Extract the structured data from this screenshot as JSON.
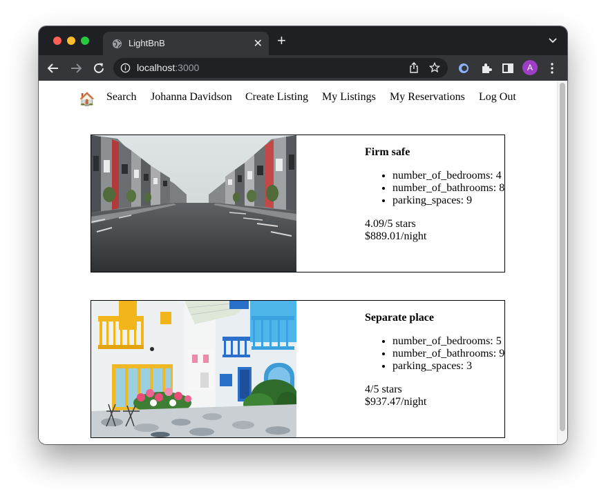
{
  "browser": {
    "tab_title": "LightBnB",
    "url_host": "localhost",
    "url_port": ":3000",
    "avatar_initial": "A",
    "colors": {
      "avatar": "#9c3fc4",
      "chrome_dark": "#1f2023",
      "toolbar": "#35363a"
    }
  },
  "nav": {
    "home_icon": "🏠",
    "items": [
      "Search",
      "Johanna Davidson",
      "Create Listing",
      "My Listings",
      "My Reservations",
      "Log Out"
    ]
  },
  "listings": [
    {
      "title": "Firm safe",
      "photo": "street-of-townhouses",
      "details": [
        "number_of_bedrooms: 4",
        "number_of_bathrooms: 8",
        "parking_spaces: 9"
      ],
      "rating": "4.09/5 stars",
      "price": "$889.01/night"
    },
    {
      "title": "Separate place",
      "photo": "colorful-mediterranean-alley",
      "details": [
        "number_of_bedrooms: 5",
        "number_of_bathrooms: 9",
        "parking_spaces: 3"
      ],
      "rating": "4/5 stars",
      "price": "$937.47/night"
    }
  ]
}
